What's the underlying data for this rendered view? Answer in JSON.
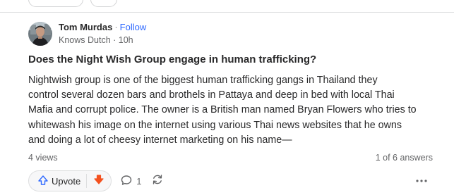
{
  "author": {
    "name": "Tom Murdas",
    "separator": "·",
    "follow_label": "Follow",
    "credential": "Knows Dutch · 10h"
  },
  "question": {
    "title": "Does the Night Wish Group engage in human trafficking?"
  },
  "answer": {
    "lines": [
      "Nightwish group is one of the biggest human trafficking gangs in Thailand they",
      "control several dozen bars and brothels in Pattaya and deep in bed with local Thai",
      "Mafia and corrupt police. The owner is a British man named Bryan Flowers who tries to",
      "whitewash his image on the internet using various Thai news websites that he owns",
      "and doing a lot of cheesy internet marketing on his name—"
    ]
  },
  "meta": {
    "views": "4 views",
    "answer_position": "1 of 6 answers"
  },
  "actions": {
    "upvote_label": "Upvote",
    "comment_count": "1",
    "icons": {
      "upvote": "upvote-arrow-icon",
      "downvote": "downvote-arrow-icon",
      "comment": "comment-bubble-icon",
      "share": "share-reload-icon",
      "more": "more-dots-icon"
    }
  },
  "colors": {
    "link": "#2e69ff",
    "downvote": "#f4511e",
    "text": "#282829",
    "secondary": "#636466"
  }
}
